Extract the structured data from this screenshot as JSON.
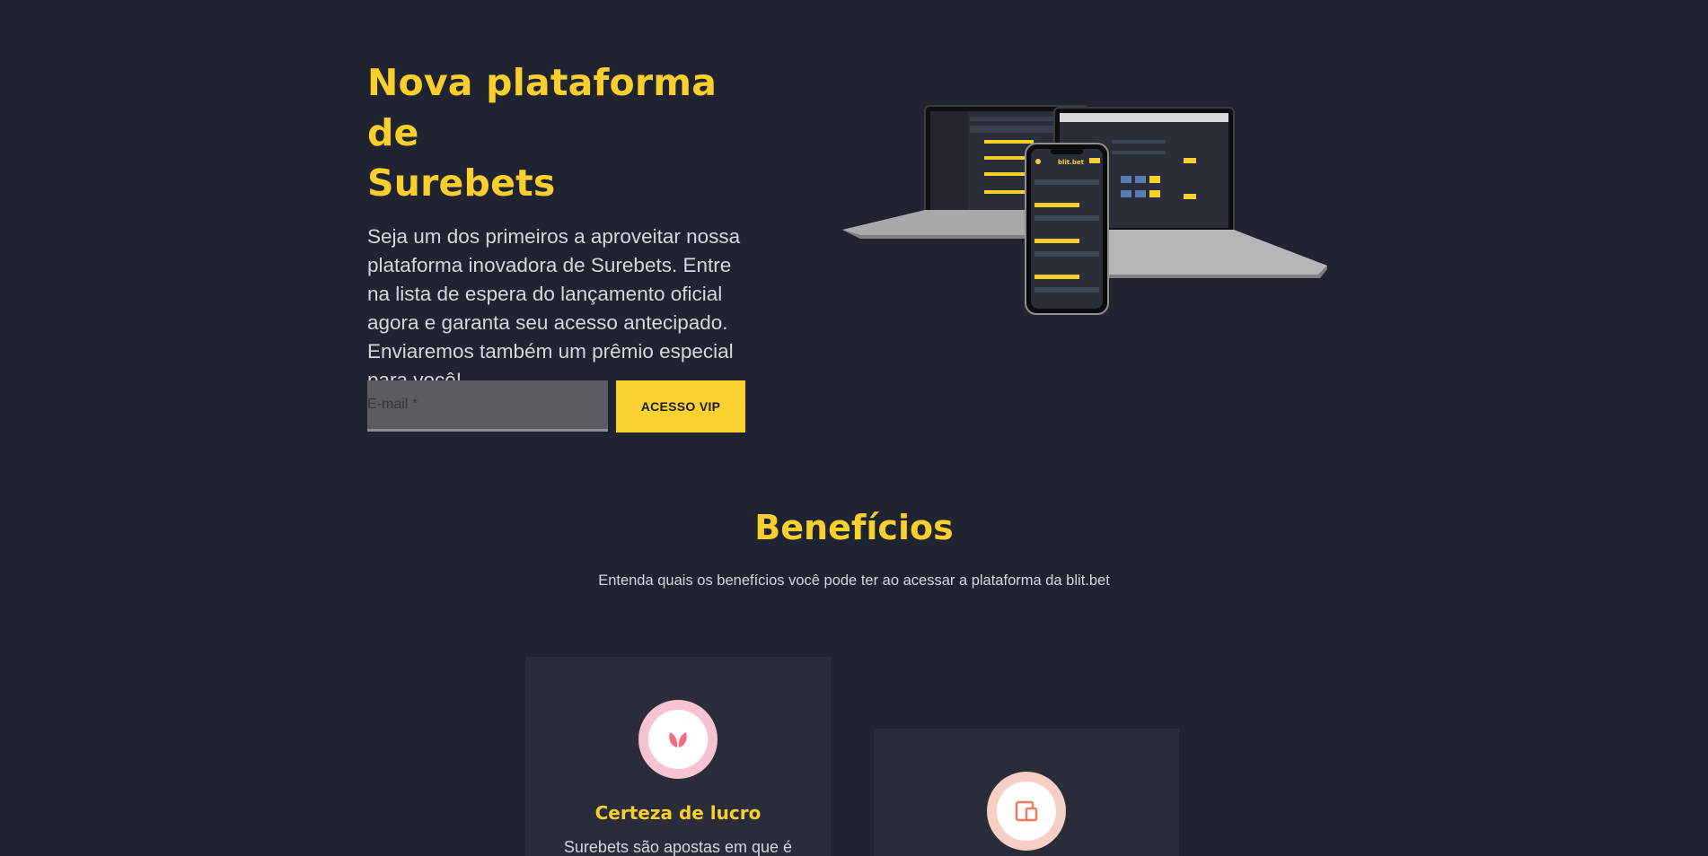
{
  "hero": {
    "title_line1": "Nova plataforma de",
    "title_line2": "Surebets",
    "description": "Seja um dos primeiros a aproveitar nossa plataforma inovadora de Surebets. Entre na lista de espera do lançamento oficial agora e garanta seu acesso antecipado. Enviaremos também um prêmio especial para você!"
  },
  "form": {
    "email_placeholder": "E-mail *",
    "email_value": "",
    "submit_label": "ACESSO VIP"
  },
  "benefits": {
    "title": "Benefícios",
    "subtitle": "Entenda quais os benefícios você pode ter ao acessar a plataforma da blit.bet",
    "cards": [
      {
        "title": "Certeza de lucro",
        "text": "Surebets são apostas em que é",
        "icon": "leaf-icon"
      },
      {
        "title": "",
        "text": "",
        "icon": "devices-icon"
      }
    ]
  },
  "mockup": {
    "brand_label": "blit.bet"
  },
  "colors": {
    "background": "#1f2430",
    "accent": "#f9cf2e",
    "card": "#282d39"
  }
}
